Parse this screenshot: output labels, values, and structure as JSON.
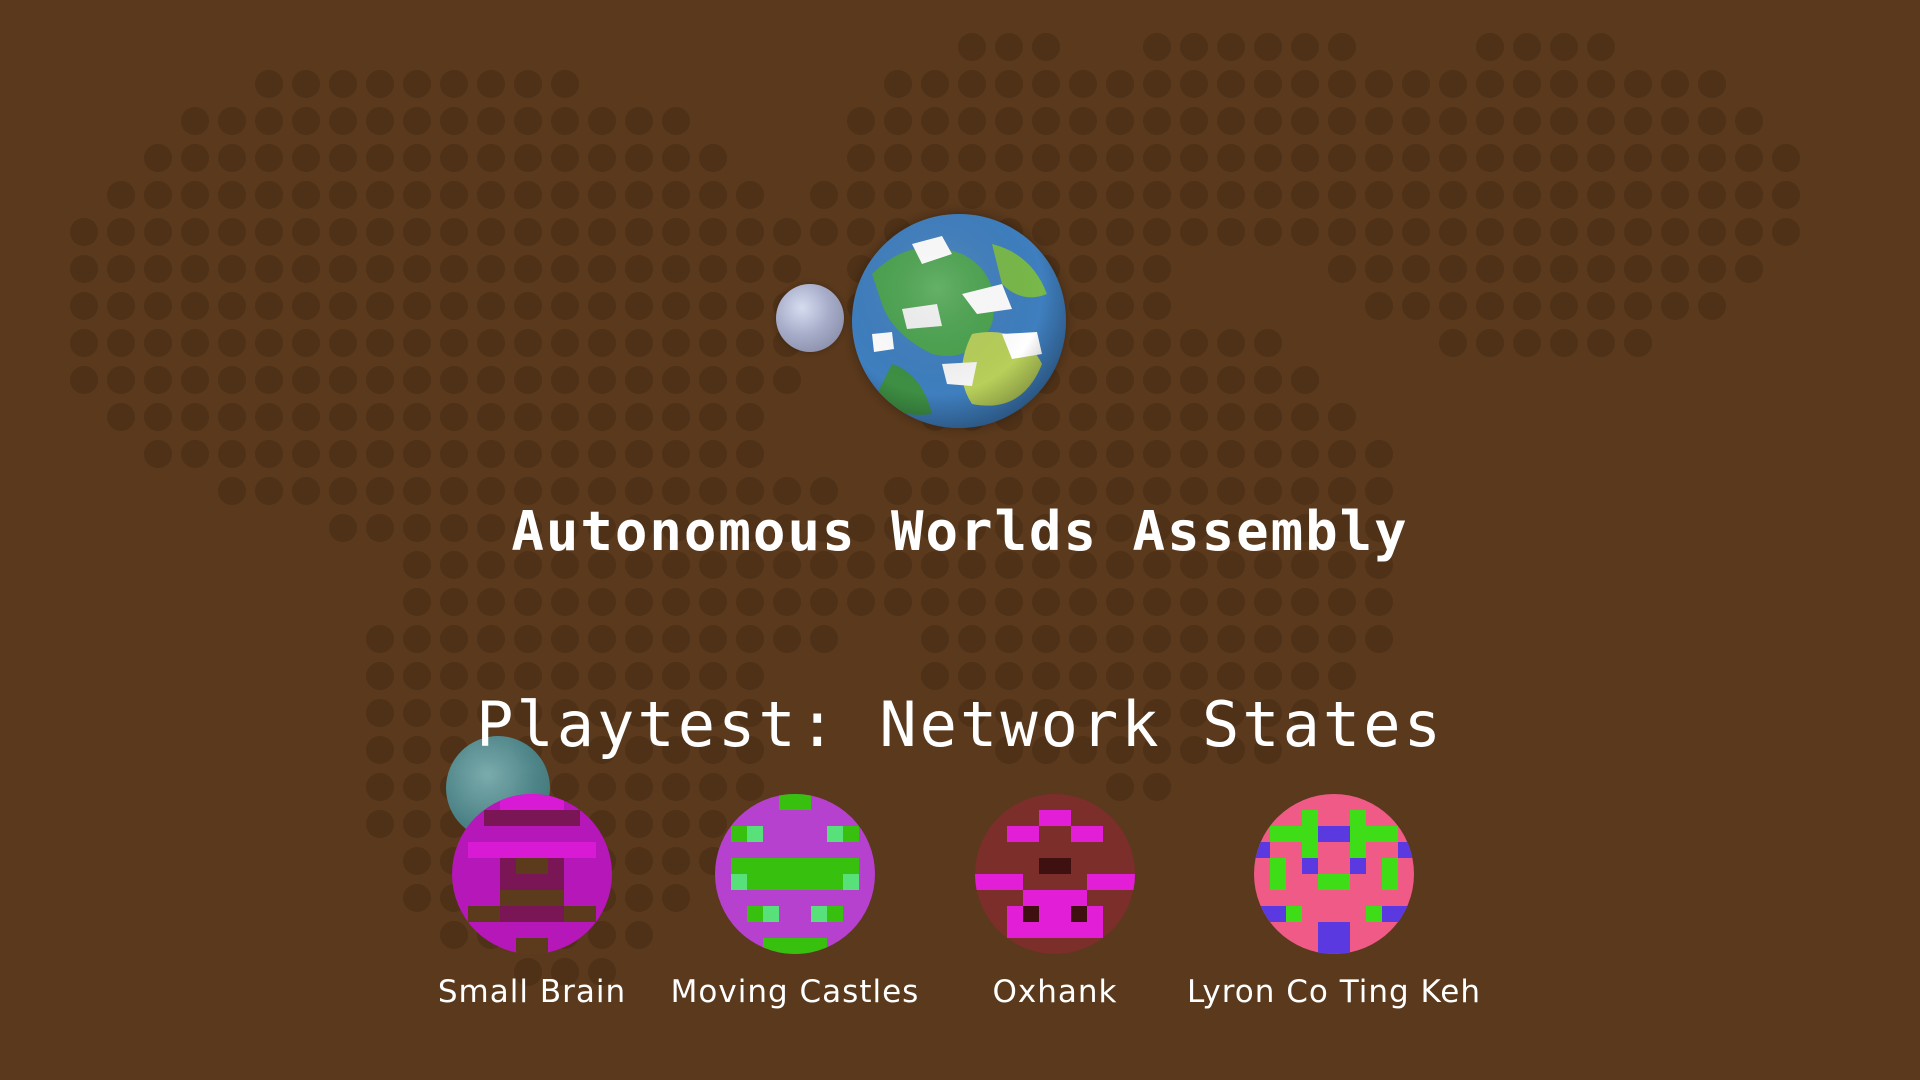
{
  "title": "Autonomous Worlds Assembly",
  "subtitle": "Playtest: Network States",
  "colors": {
    "background": "#5a391c",
    "dots": "#4e3117",
    "text": "#ffffff"
  },
  "teams": [
    {
      "name": "Small Brain",
      "avatar_palette": [
        "#b617b8",
        "#7a1656",
        "#5c3a1c",
        "#d81ad4"
      ]
    },
    {
      "name": "Moving Castles",
      "avatar_palette": [
        "#b641cf",
        "#38c00f",
        "#58e07a"
      ]
    },
    {
      "name": "Oxhank",
      "avatar_palette": [
        "#7b2e2a",
        "#e21fd7",
        "#3e1010"
      ]
    },
    {
      "name": "Lyron Co Ting Keh",
      "avatar_palette": [
        "#ef5b86",
        "#3fdc18",
        "#5a3ae0"
      ]
    }
  ]
}
